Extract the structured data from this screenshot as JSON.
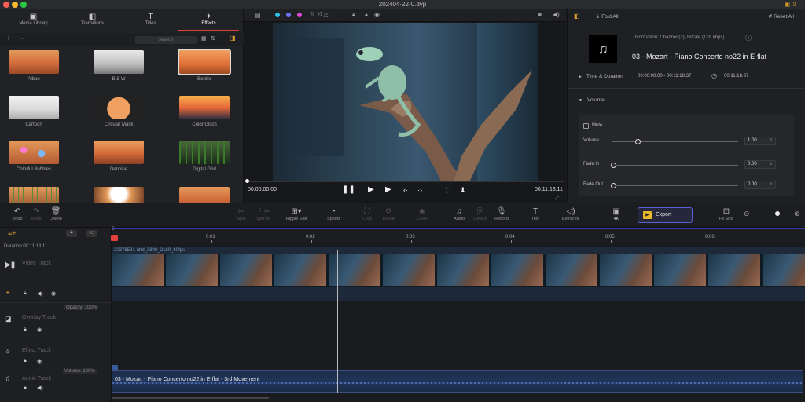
{
  "window": {
    "title": "202404-22-0.dvp"
  },
  "left_panel": {
    "tabs": [
      {
        "label": "Media Library",
        "icon": "media-library-icon"
      },
      {
        "label": "Transitions",
        "icon": "transitions-icon"
      },
      {
        "label": "Titles",
        "icon": "titles-icon"
      },
      {
        "label": "Effects",
        "icon": "effects-icon",
        "active": true
      }
    ],
    "search_placeholder": "Search",
    "effects": [
      {
        "label": "Albao"
      },
      {
        "label": "B & W"
      },
      {
        "label": "Border",
        "selected": true
      },
      {
        "label": "Cartoon"
      },
      {
        "label": "Circular Mask"
      },
      {
        "label": "Color Glitch"
      },
      {
        "label": "Colorful Bubbles"
      },
      {
        "label": "Denoise"
      },
      {
        "label": "Digital Grid"
      },
      {
        "label": ""
      },
      {
        "label": ""
      },
      {
        "label": ""
      }
    ]
  },
  "preview": {
    "current_time": "00:00:00.00",
    "total_time": "00:11:18.11"
  },
  "inspector": {
    "fold_all": "Fold All",
    "reset_all": "Reset All",
    "info": "Information: Channel (2), Bitrate (128 kbps)",
    "file_title": "03 - Mozart - Piano Concerto no22 in E-flat",
    "time_duration_label": "Time & Duration",
    "time_range": "00:00:00.00 - 00:11:18.37",
    "duration": "00:11:18.37",
    "volume_section": "Volume",
    "mute": "Mute",
    "volume_label": "Volume",
    "volume_value": "1.00",
    "volume_level": 0.2,
    "fade_in_label": "Fade In",
    "fade_in_value": "0.00",
    "fade_out_label": "Fade Out",
    "fade_out_value": "0.00"
  },
  "toolbar": {
    "undo": "Undo",
    "redo": "Redo",
    "delete": "Delete",
    "split": "Split",
    "split_all": "Split All",
    "ripple_edit": "Ripple Edit",
    "speed": "Speed",
    "crop": "Crop",
    "rotate": "Rotate",
    "color": "Color",
    "audio": "Audio",
    "detach": "Detach",
    "record": "Record",
    "text": "Text",
    "extractor": "Extractor",
    "res": "4K",
    "export": "Export",
    "fit_size": "Fit Size"
  },
  "timeline": {
    "duration": "Duration:00:11:18.11",
    "ticks": [
      "0",
      "0:01",
      "0:02",
      "0:03",
      "0:04",
      "0:05",
      "0:06"
    ],
    "tracks": {
      "video": "Video Track",
      "overlay": "Overlay Track",
      "effect": "Effect Track",
      "audio": "Audio Track"
    },
    "opacity": "Opacity: 100%",
    "volume": "Volume: 100%",
    "video_clip_name": "20378591-uhd_3840_2160_60fps",
    "audio_clip_name": "03 - Mozart - Piano Concerto no22 in E-flat - 3rd Movement"
  }
}
